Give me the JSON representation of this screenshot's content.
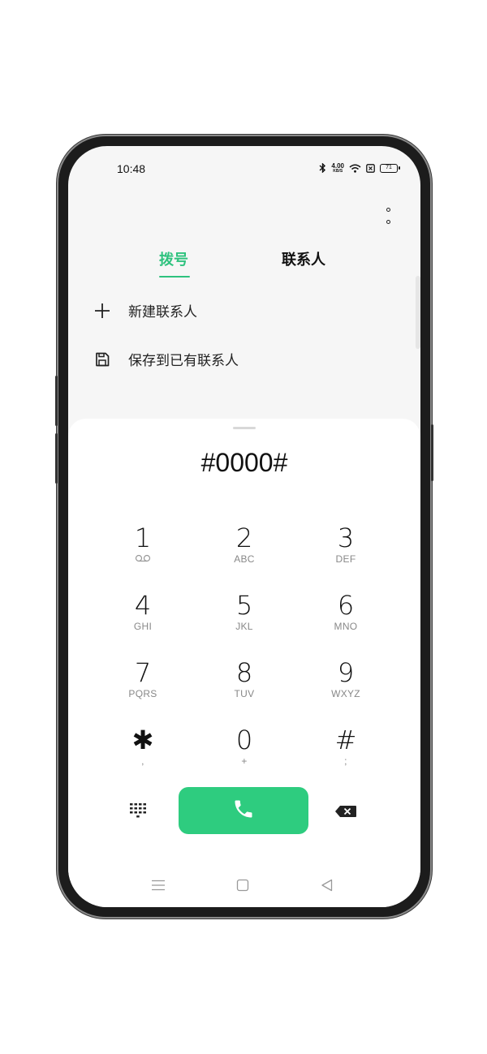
{
  "status": {
    "time": "10:48",
    "net_speed": "4.00",
    "net_unit": "KB/S",
    "battery": "71"
  },
  "tabs": [
    {
      "label": "拨号",
      "active": true
    },
    {
      "label": "联系人",
      "active": false
    }
  ],
  "actions": {
    "new_contact": "新建联系人",
    "save_to_existing": "保存到已有联系人"
  },
  "dialer": {
    "number": "#0000#",
    "keys": [
      {
        "digit": "1",
        "letters": ""
      },
      {
        "digit": "2",
        "letters": "ABC"
      },
      {
        "digit": "3",
        "letters": "DEF"
      },
      {
        "digit": "4",
        "letters": "GHI"
      },
      {
        "digit": "5",
        "letters": "JKL"
      },
      {
        "digit": "6",
        "letters": "MNO"
      },
      {
        "digit": "7",
        "letters": "PQRS"
      },
      {
        "digit": "8",
        "letters": "TUV"
      },
      {
        "digit": "9",
        "letters": "WXYZ"
      },
      {
        "digit": "✱",
        "letters": ","
      },
      {
        "digit": "0",
        "letters": "+"
      },
      {
        "digit": "#",
        "letters": ";"
      }
    ]
  },
  "colors": {
    "accent": "#2ec27e",
    "call_button": "#2ecc7f"
  },
  "icons": {
    "bluetooth": "bluetooth-icon",
    "wifi": "wifi-icon",
    "sim": "sim-icon",
    "more": "more-vertical-icon",
    "add": "plus-icon",
    "save": "save-icon",
    "voicemail": "voicemail-icon",
    "dialpad": "dialpad-icon",
    "call": "phone-icon",
    "delete": "backspace-icon",
    "nav_menu": "menu-icon",
    "nav_home": "home-icon",
    "nav_back": "back-icon"
  }
}
